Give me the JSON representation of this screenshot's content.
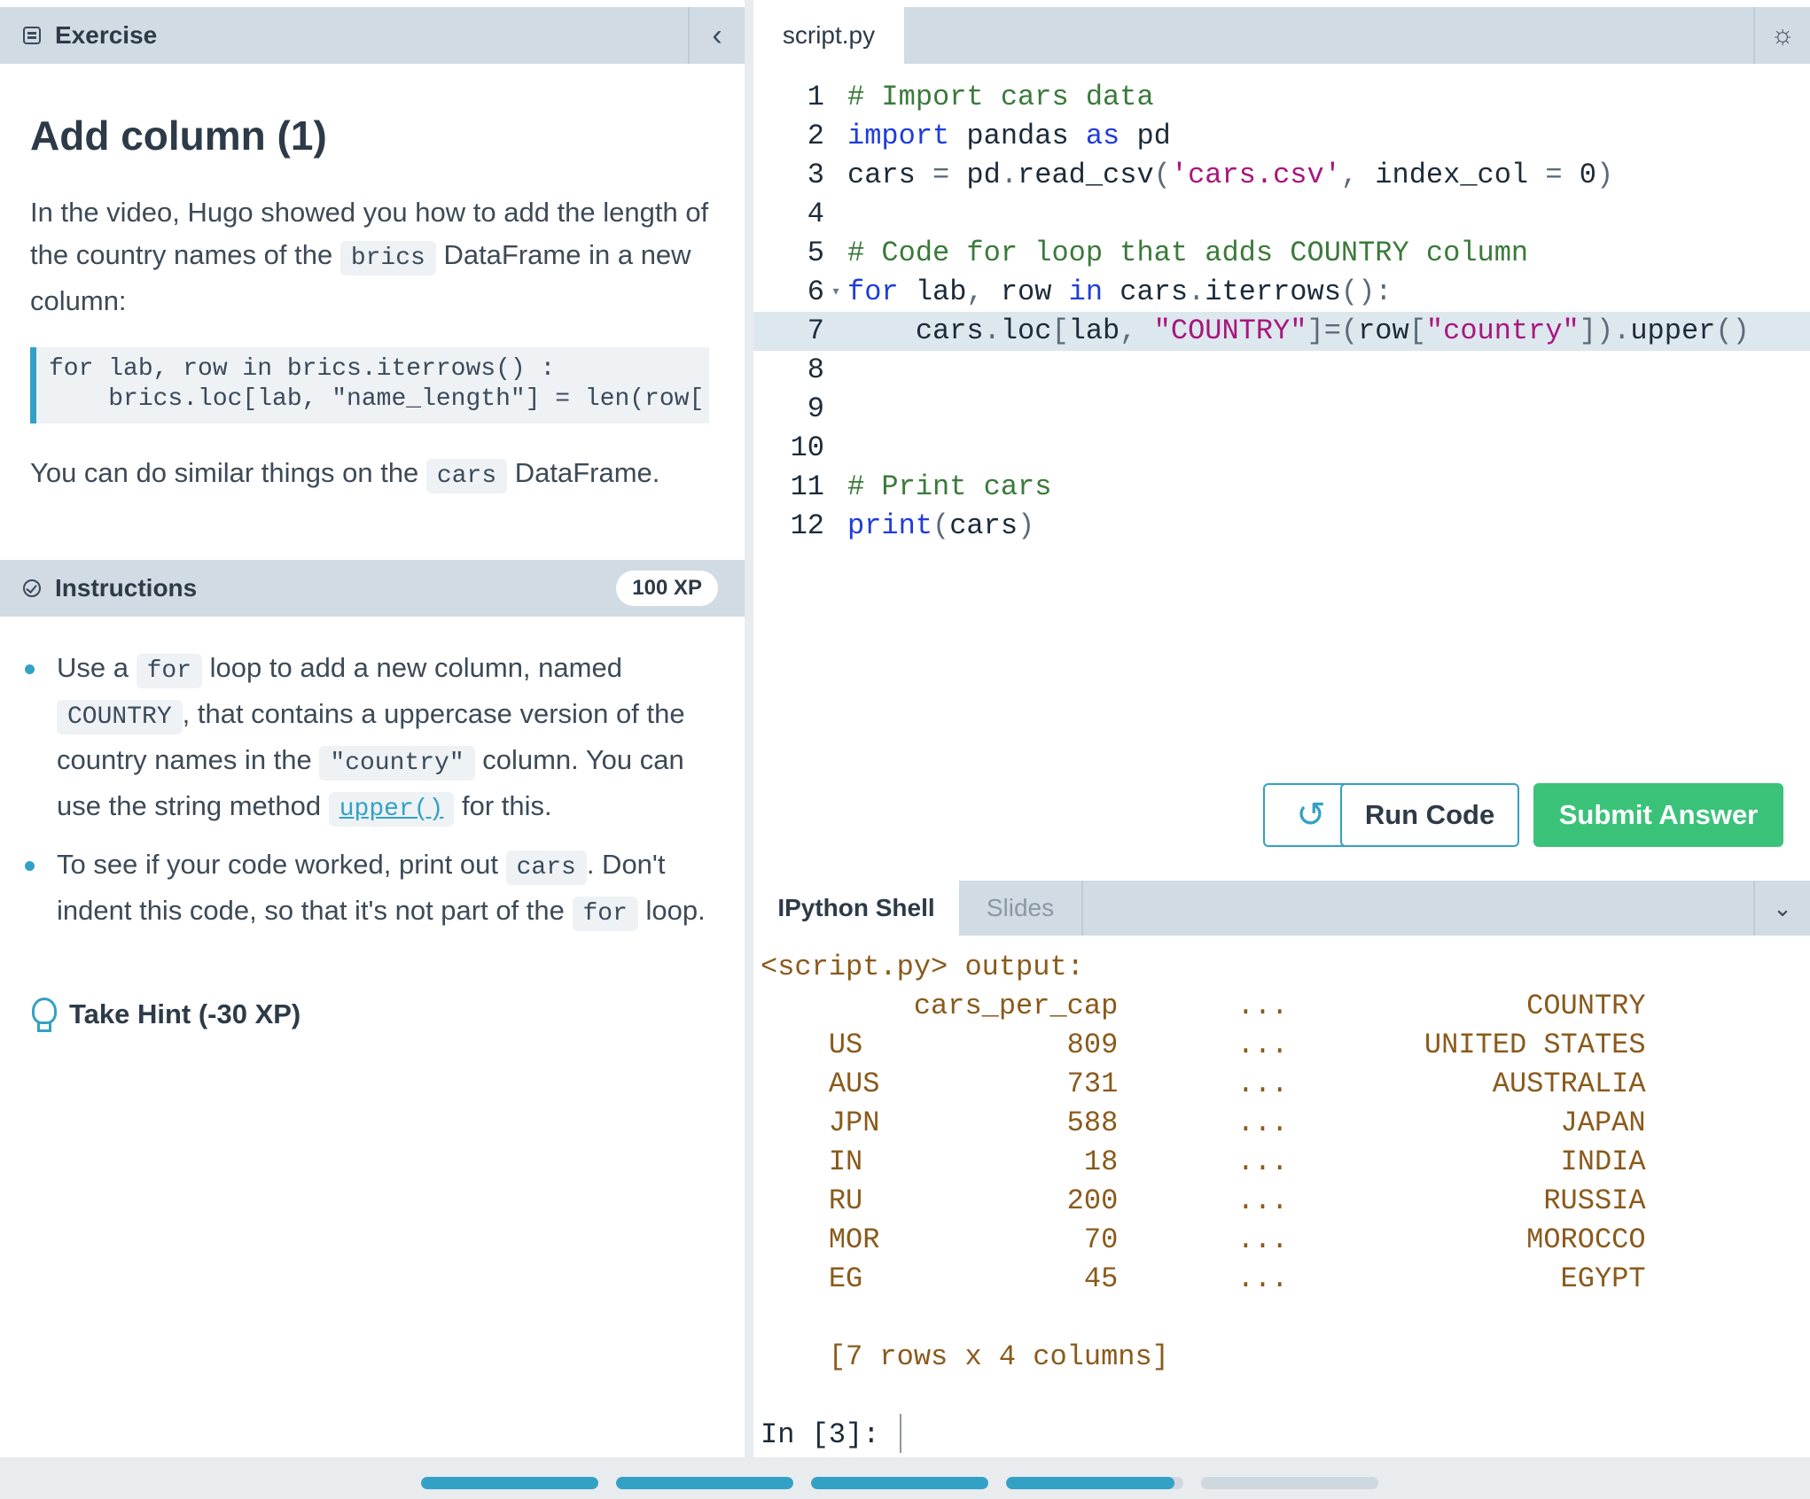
{
  "exercise": {
    "header": "Exercise",
    "title": "Add column (1)",
    "p1_a": "In the video, Hugo showed you how to add the length of the country names of the ",
    "p1_code": "brics",
    "p1_b": " DataFrame in a new column:",
    "snippet_lines": [
      "for lab, row in brics.iterrows() :",
      "    brics.loc[lab, \"name_length\"] = len(row['"
    ],
    "p2_a": "You can do similar things on the ",
    "p2_code": "cars",
    "p2_b": " DataFrame."
  },
  "instructions": {
    "header": "Instructions",
    "xp": "100 XP",
    "b1": {
      "a": "Use a ",
      "code1": "for",
      "b": " loop to add a new column, named ",
      "code2": "COUNTRY",
      "c": ", that contains a uppercase version of the country names in the ",
      "code3": "\"country\"",
      "d": " column. You can use the string method ",
      "link": "upper()",
      "e": " for this."
    },
    "b2": {
      "a": "To see if your code worked, print out ",
      "code1": "cars",
      "b": ". Don't indent this code, so that it's not part of the ",
      "code2": "for",
      "c": " loop."
    },
    "hint": "Take Hint (-30 XP)"
  },
  "editor": {
    "filename": "script.py",
    "lines": [
      {
        "n": "1",
        "t": "# Import cars data"
      },
      {
        "n": "2",
        "t": "import pandas as pd"
      },
      {
        "n": "3",
        "t": "cars = pd.read_csv('cars.csv', index_col = 0)"
      },
      {
        "n": "4",
        "t": ""
      },
      {
        "n": "5",
        "t": "# Code for loop that adds COUNTRY column"
      },
      {
        "n": "6",
        "t": "for lab, row in cars.iterrows():"
      },
      {
        "n": "7",
        "t": "    cars.loc[lab, \"COUNTRY\"]=(row[\"country\"]).upper()"
      },
      {
        "n": "8",
        "t": ""
      },
      {
        "n": "9",
        "t": ""
      },
      {
        "n": "10",
        "t": ""
      },
      {
        "n": "11",
        "t": "# Print cars"
      },
      {
        "n": "12",
        "t": "print(cars)"
      }
    ],
    "run_label": "Run Code",
    "submit_label": "Submit Answer"
  },
  "shell": {
    "tabs": [
      "IPython Shell",
      "Slides"
    ],
    "output_lines": [
      "<script.py> output:",
      "         cars_per_cap       ...              COUNTRY",
      "    US            809       ...        UNITED STATES",
      "    AUS           731       ...            AUSTRALIA",
      "    JPN           588       ...                JAPAN",
      "    IN             18       ...                INDIA",
      "    RU            200       ...               RUSSIA",
      "    MOR            70       ...              MOROCCO",
      "    EG             45       ...                EGYPT",
      "",
      "    [7 rows x 4 columns]"
    ],
    "prompt": "In [3]: "
  },
  "progress": {
    "segments": [
      1,
      1,
      1,
      0.95,
      0
    ]
  },
  "colors": {
    "accent": "#33a1c5",
    "submit": "#3ac279",
    "header_bg": "#d0dbe4"
  }
}
